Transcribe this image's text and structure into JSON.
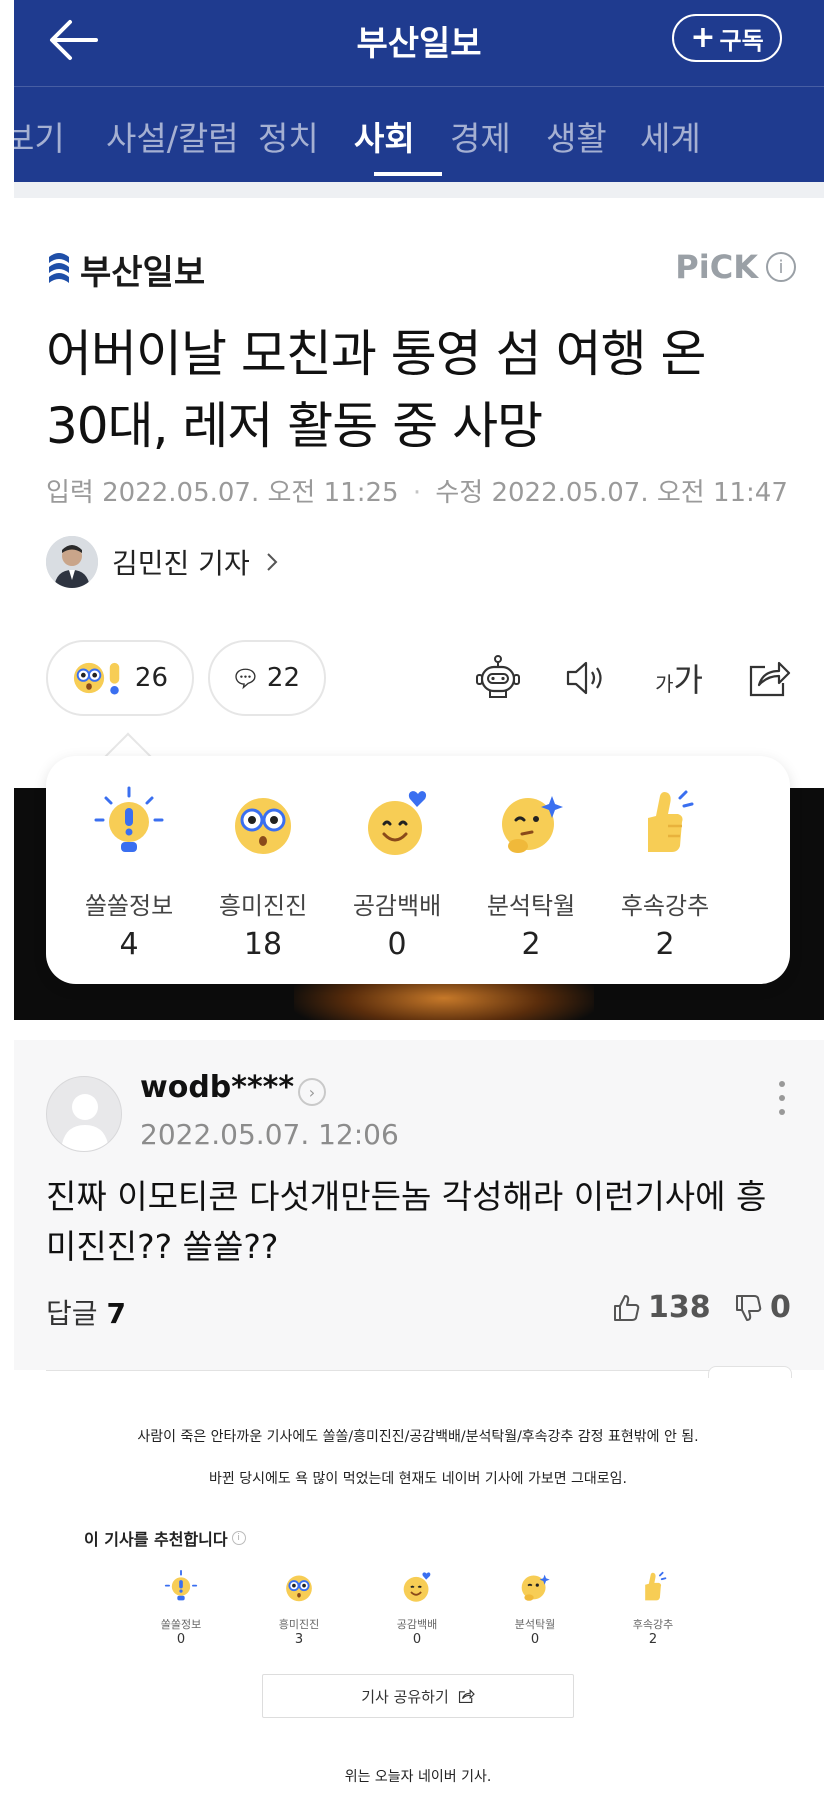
{
  "header": {
    "title": "부산일보",
    "subscribe_label": "구독",
    "subscribe_plus": "+"
  },
  "tabs": [
    {
      "label": "보기",
      "active": false
    },
    {
      "label": "사설/칼럼",
      "active": false
    },
    {
      "label": "정치",
      "active": false
    },
    {
      "label": "사회",
      "active": true
    },
    {
      "label": "경제",
      "active": false
    },
    {
      "label": "생활",
      "active": false
    },
    {
      "label": "세계",
      "active": false
    }
  ],
  "press": {
    "name": "부산일보",
    "pick_label": "PiCK",
    "pick_info": "i"
  },
  "article": {
    "headline_line1": "어버이날 모친과 통영 섬 여행 온",
    "headline_line2": "30대, 레저 활동 중 사망",
    "published_label": "입력",
    "published": "2022.05.07. 오전 11:25",
    "modified_label": "수정",
    "modified": "2022.05.07. 오전 11:47",
    "reporter": "김민진 기자"
  },
  "actions": {
    "reaction_count": "26",
    "comment_count": "22",
    "font_label_small": "가",
    "font_label_large": "가"
  },
  "reactions": [
    {
      "label": "쏠쏠정보",
      "count": "4"
    },
    {
      "label": "흥미진진",
      "count": "18"
    },
    {
      "label": "공감백배",
      "count": "0"
    },
    {
      "label": "분석탁월",
      "count": "2"
    },
    {
      "label": "후속강추",
      "count": "2"
    }
  ],
  "comment": {
    "user": "wodb****",
    "date": "2022.05.07. 12:06",
    "text_line1": "진짜 이모티콘 다섯개만든놈 각성해라 이런기사에 흥",
    "text_line2": "미진진?? 쏠쏠??",
    "reply_label": "답글",
    "reply_count": "7",
    "likes": "138",
    "dislikes": "0"
  },
  "notes": {
    "line1": "사람이 죽은 안타까운 기사에도 쏠쏠/흥미진진/공감백배/분석탁월/후속강추 감정 표현밖에 안 됨.",
    "line2": "바뀐 당시에도 욕 많이 먹었는데 현재도 네이버 기사에 가보면 그대로임."
  },
  "recommend": {
    "title": "이 기사를 추천합니다",
    "info": "i",
    "items": [
      {
        "label": "쏠쏠정보",
        "count": "0"
      },
      {
        "label": "흥미진진",
        "count": "3"
      },
      {
        "label": "공감백배",
        "count": "0"
      },
      {
        "label": "분석탁월",
        "count": "0"
      },
      {
        "label": "후속강추",
        "count": "2"
      }
    ],
    "share_label": "기사 공유하기"
  },
  "footer": {
    "note": "위는 오늘자 네이버 기사."
  },
  "colors": {
    "header_bg": "#1f3b8f",
    "emoji_yellow": "#f7cd55",
    "emoji_blue": "#3a6ff0"
  }
}
